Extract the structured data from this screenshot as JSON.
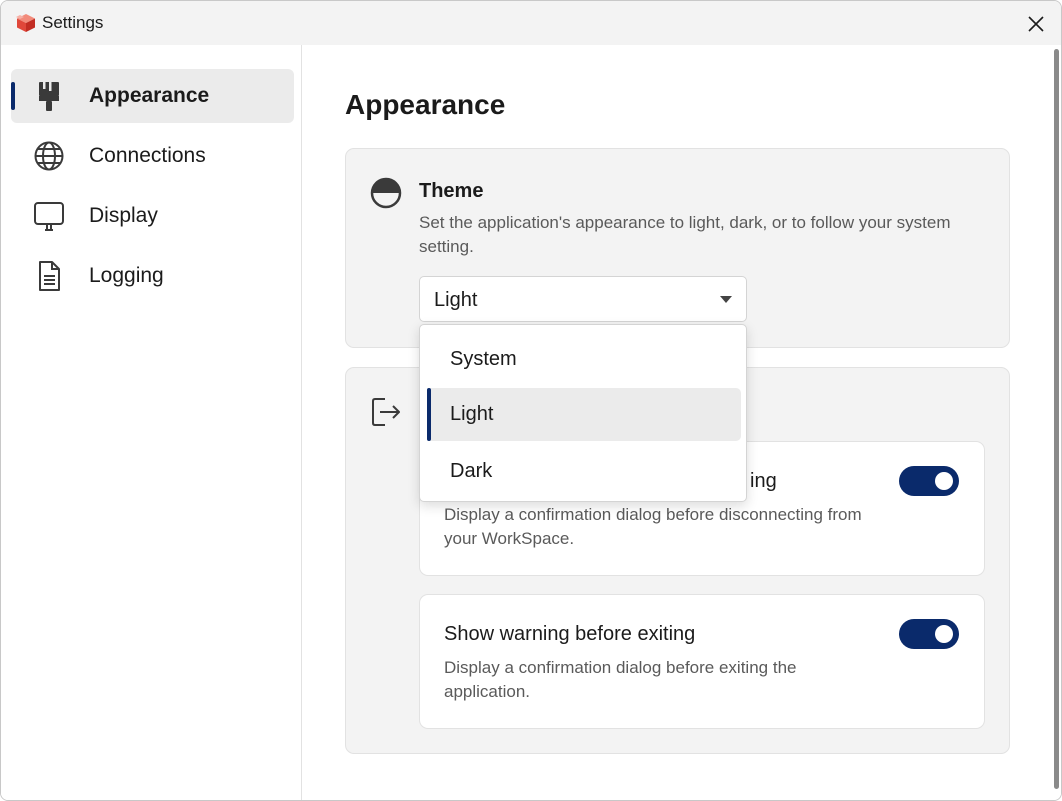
{
  "window": {
    "title": "Settings"
  },
  "colors": {
    "accent": "#0a2a6b",
    "card_bg": "#f3f3f3",
    "selected_bg": "#ebebeb"
  },
  "sidebar": {
    "items": [
      {
        "label": "Appearance",
        "icon": "paintbrush-icon",
        "active": true
      },
      {
        "label": "Connections",
        "icon": "globe-icon",
        "active": false
      },
      {
        "label": "Display",
        "icon": "monitor-icon",
        "active": false
      },
      {
        "label": "Logging",
        "icon": "document-icon",
        "active": false
      }
    ]
  },
  "main": {
    "title": "Appearance",
    "theme": {
      "icon": "half-circle-icon",
      "title": "Theme",
      "description": "Set the application's appearance to light, dark, or to follow your system setting.",
      "selected": "Light",
      "options": [
        "System",
        "Light",
        "Dark"
      ]
    },
    "exit_section": {
      "icon": "exit-icon",
      "settings": [
        {
          "title": "ing",
          "description": "Display a confirmation dialog before disconnecting from your WorkSpace.",
          "enabled": true
        },
        {
          "title": "Show warning before exiting",
          "description": "Display a confirmation dialog before exiting the application.",
          "enabled": true
        }
      ]
    }
  }
}
